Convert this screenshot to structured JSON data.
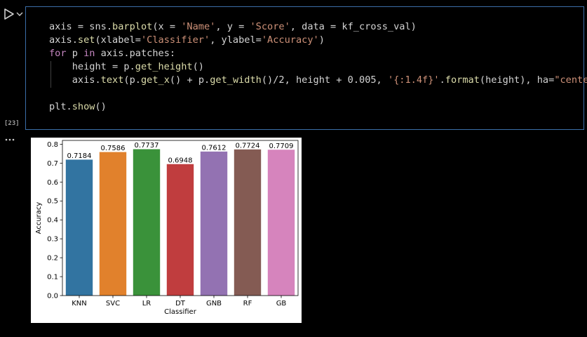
{
  "cell": {
    "execution_count": "[23]",
    "code_lines": [
      [
        [
          "p",
          "axis = sns."
        ],
        [
          "f",
          "barplot"
        ],
        [
          "p",
          "(x = "
        ],
        [
          "s",
          "'Name'"
        ],
        [
          "p",
          ", y = "
        ],
        [
          "s",
          "'Score'"
        ],
        [
          "p",
          ", data = kf_cross_val)"
        ]
      ],
      [
        [
          "p",
          "axis."
        ],
        [
          "f",
          "set"
        ],
        [
          "p",
          "(xlabel="
        ],
        [
          "s",
          "'Classifier'"
        ],
        [
          "p",
          ", ylabel="
        ],
        [
          "s",
          "'Accuracy'"
        ],
        [
          "p",
          ")"
        ]
      ],
      [
        [
          "k",
          "for"
        ],
        [
          "p",
          " p "
        ],
        [
          "k",
          "in"
        ],
        [
          "p",
          " axis.patches:"
        ]
      ],
      [
        [
          "p",
          "    height = p."
        ],
        [
          "f",
          "get_height"
        ],
        [
          "p",
          "()"
        ]
      ],
      [
        [
          "p",
          "    axis."
        ],
        [
          "f",
          "text"
        ],
        [
          "p",
          "(p."
        ],
        [
          "f",
          "get_x"
        ],
        [
          "p",
          "() + p."
        ],
        [
          "f",
          "get_width"
        ],
        [
          "p",
          "()/2, height + 0.005, "
        ],
        [
          "s",
          "'{:1.4f}'"
        ],
        [
          "p",
          "."
        ],
        [
          "f",
          "format"
        ],
        [
          "p",
          "(height), ha="
        ],
        [
          "s",
          "\"center\""
        ],
        [
          "p",
          ")"
        ]
      ],
      [
        [
          "p",
          ""
        ]
      ],
      [
        [
          "p",
          "plt."
        ],
        [
          "f",
          "show"
        ],
        [
          "p",
          "()"
        ]
      ]
    ]
  },
  "colors": {
    "cell_border": "#3b6ea8",
    "keyword": "#c586c0",
    "string": "#ce9178",
    "function": "#dcdcaa",
    "plain": "#d4d4d4"
  },
  "icons": {
    "run": "run-triangle-icon",
    "chevron": "chevron-down-icon",
    "output": "ellipsis-icon"
  },
  "chart_data": {
    "type": "bar",
    "categories": [
      "KNN",
      "SVC",
      "LR",
      "DT",
      "GNB",
      "RF",
      "GB"
    ],
    "values": [
      0.7184,
      0.7586,
      0.7737,
      0.6948,
      0.7612,
      0.7724,
      0.7709
    ],
    "value_labels": [
      "0.7184",
      "0.7586",
      "0.7737",
      "0.6948",
      "0.7612",
      "0.7724",
      "0.7709"
    ],
    "colors": [
      "#3274a1",
      "#e1812c",
      "#3a923a",
      "#c03d3e",
      "#9372b2",
      "#845b53",
      "#d684bd"
    ],
    "xlabel": "Classifier",
    "ylabel": "Accuracy",
    "ylim": [
      0,
      0.82
    ],
    "yticks": [
      0.0,
      0.1,
      0.2,
      0.3,
      0.4,
      0.5,
      0.6,
      0.7,
      0.8
    ],
    "ytick_labels": [
      "0.0",
      "0.1",
      "0.2",
      "0.3",
      "0.4",
      "0.5",
      "0.6",
      "0.7",
      "0.8"
    ],
    "grid": false,
    "legend": "none"
  }
}
